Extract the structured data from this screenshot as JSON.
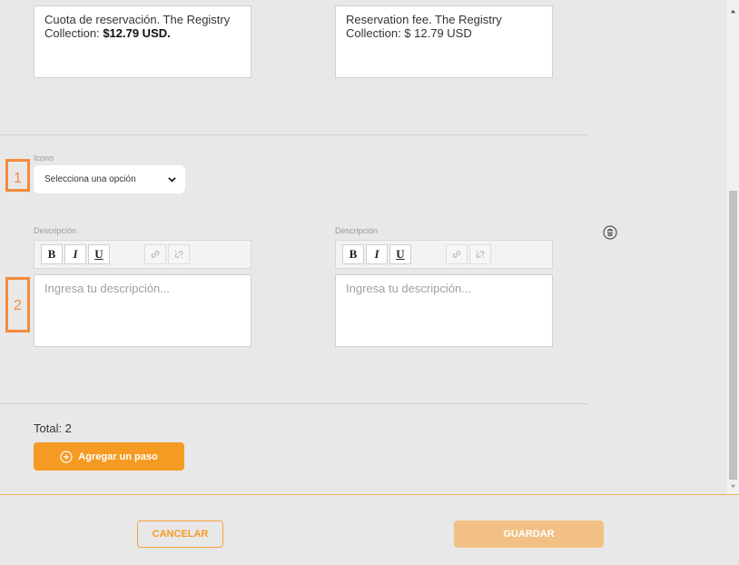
{
  "step1": {
    "es_text_plain": "Cuota de reservación. The Registry Collection: ",
    "es_text_bold": "$12.79 USD.",
    "en_text": "Reservation fee. The Registry Collection: $ 12.79 USD"
  },
  "step2": {
    "marker_icon": "1",
    "marker_desc": "2",
    "icon_label": "Icono",
    "icon_select_value": "Selecciona una opción",
    "desc_label_es": "Descripción",
    "desc_label_en": "Descripción",
    "desc_placeholder_es": "Ingresa tu descripción...",
    "desc_placeholder_en": "Ingresa tu descripción...",
    "toolbar": {
      "bold": "B",
      "italic": "I",
      "underline": "U"
    }
  },
  "total_text": "Total: 2",
  "add_step_label": "Agregar un paso",
  "footer": {
    "cancel_label": "CANCELAR",
    "save_label": "GUARDAR"
  },
  "colors": {
    "accent": "#f59a23",
    "marker": "#f58a3b",
    "save_disabled": "#f2c084"
  },
  "icons": [
    "chevron-down-icon",
    "bold-icon",
    "italic-icon",
    "underline-icon",
    "link-icon",
    "unlink-icon",
    "trash-icon",
    "plus-circle-icon"
  ]
}
